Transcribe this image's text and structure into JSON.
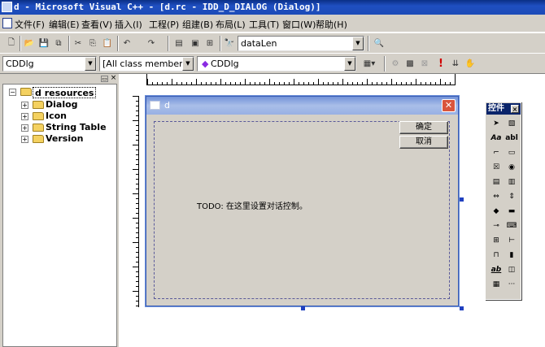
{
  "window": {
    "title": "d - Microsoft Visual C++ - [d.rc - IDD_D_DIALOG (Dialog)]"
  },
  "menu": [
    "文件(F)",
    "编辑(E)",
    "查看(V)",
    "插入(I)",
    "工程(P)",
    "组建(B)",
    "布局(L)",
    "工具(T)",
    "窗口(W)",
    "帮助(H)"
  ],
  "toolbar1": {
    "find_combo_value": "dataLen",
    "icons": [
      "new-file-icon",
      "open-icon",
      "save-icon",
      "save-all-icon",
      "cut-icon",
      "copy-icon",
      "paste-icon",
      "undo-icon",
      "redo-icon",
      "workspace-icon",
      "output-icon",
      "window-list-icon",
      "find-in-files-icon",
      "find-icon"
    ]
  },
  "toolbar2": {
    "class_combo": "CDDlg",
    "filter_combo": "[All class members]",
    "member_combo": "CDDlg",
    "icons": [
      "wizard-action-icon",
      "compile-icon",
      "build-icon",
      "stop-build-icon",
      "execute-icon",
      "go-icon",
      "breakpoint-icon"
    ]
  },
  "workspace": {
    "root": "d resources",
    "items": [
      "Dialog",
      "Icon",
      "String Table",
      "Version"
    ]
  },
  "dialog": {
    "title": "d",
    "ok_label": "确定",
    "cancel_label": "取消",
    "todo_text": "TODO: 在这里设置对话控制。"
  },
  "controls_palette": {
    "title": "控件",
    "tools": [
      "pointer",
      "picture",
      "static-text",
      "edit-box",
      "group-box",
      "button",
      "check-box",
      "radio-button",
      "combo-box",
      "list-box",
      "horizontal-scrollbar",
      "vertical-scrollbar",
      "spin",
      "progress",
      "slider",
      "hotkey",
      "list-control",
      "tree-control",
      "tab-control",
      "animate",
      "rich-edit",
      "date-time-picker",
      "month-calendar",
      "ip-address",
      "custom-control",
      "extended-combo"
    ]
  }
}
